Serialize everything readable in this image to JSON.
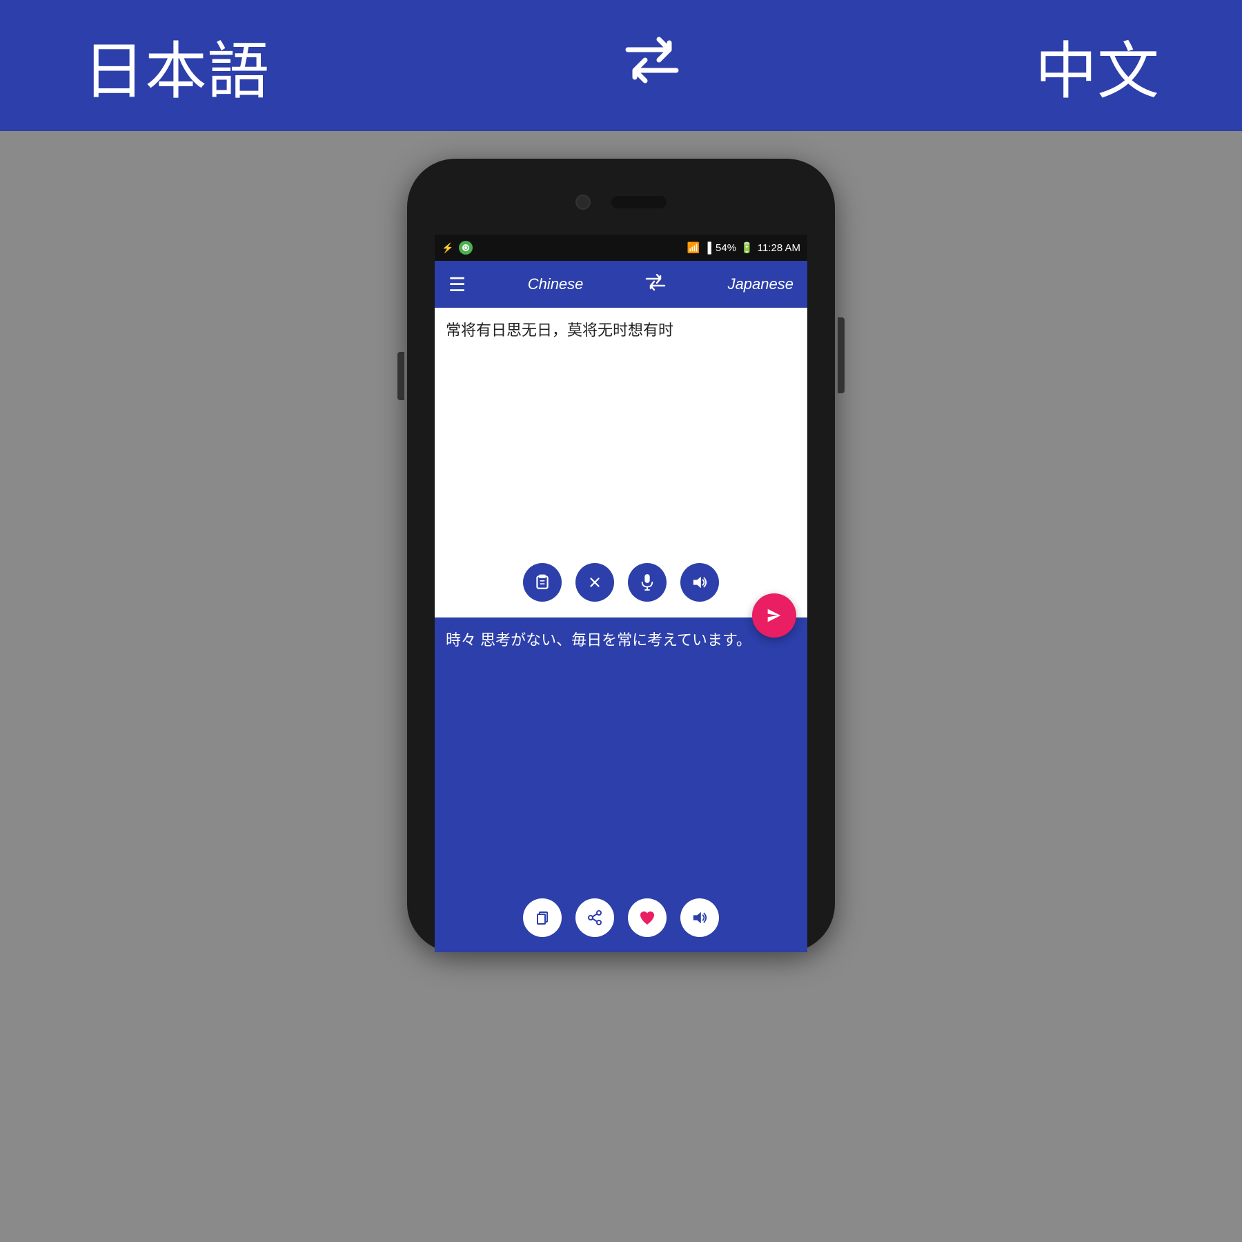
{
  "header": {
    "lang_left": "日本語",
    "lang_right": "中文",
    "swap_icon": "⇄"
  },
  "status_bar": {
    "battery": "54%",
    "time": "11:28 AM"
  },
  "app_navbar": {
    "lang_left": "Chinese",
    "lang_right": "Japanese",
    "menu_icon": "☰",
    "swap_icon": "⇄"
  },
  "input": {
    "text": "常将有日思无日，莫将无时想有时"
  },
  "output": {
    "text": "時々 思考がない、毎日を常に考えています。"
  },
  "input_buttons": {
    "clipboard": "📋",
    "clear": "✕",
    "mic": "🎤",
    "speaker": "🔊"
  },
  "output_buttons": {
    "clipboard": "📋",
    "share": "↗",
    "heart": "♥",
    "speaker": "🔊"
  }
}
